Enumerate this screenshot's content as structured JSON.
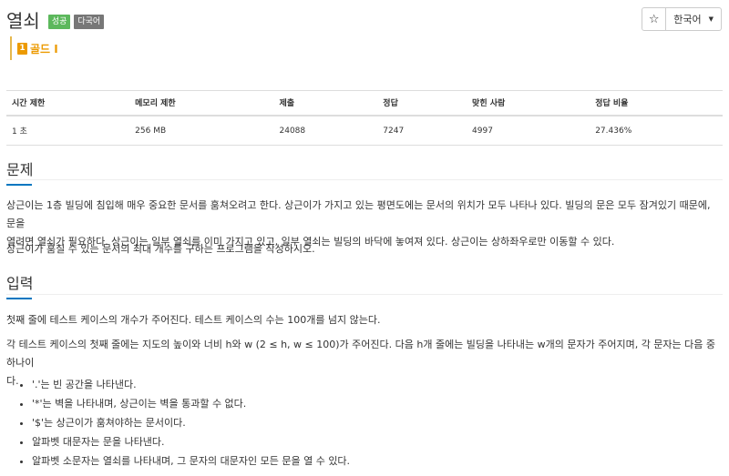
{
  "header": {
    "title": "열쇠",
    "badge_success": "성공",
    "badge_multilang": "다국어",
    "star_icon": "☆",
    "language": "한국어"
  },
  "tier": {
    "icon_text": "1",
    "label": "골드 I"
  },
  "stats": {
    "headers": [
      "시간 제한",
      "메모리 제한",
      "제출",
      "정답",
      "맞힌 사람",
      "정답 비율"
    ],
    "values": [
      "1 초",
      "256 MB",
      "24088",
      "7247",
      "4997",
      "27.436%"
    ]
  },
  "problem": {
    "title": "문제",
    "paragraph1_line1": "상근이는 1층 빌딩에 침입해 매우 중요한 문서를 훔쳐오려고 한다. 상근이가 가지고 있는 평면도에는 문서의 위치가 모두 나타나 있다. 빌딩의 문은 모두 잠겨있기 때문에, 문을",
    "paragraph1_line2": "열려면 열쇠가 필요하다. 상근이는 일부 열쇠를 이미 가지고 있고, 일부 열쇠는 빌딩의 바닥에 놓여져 있다. 상근이는 상하좌우로만 이동할 수 있다.",
    "paragraph2": "상근이가 훔칠 수 있는 문서의 최대 개수를 구하는 프로그램을 작성하시오."
  },
  "input": {
    "title": "입력",
    "paragraph1": "첫째 줄에 테스트 케이스의 개수가 주어진다. 테스트 케이스의 수는 100개를 넘지 않는다.",
    "paragraph2_line1": "각 테스트 케이스의 첫째 줄에는 지도의 높이와 너비 h와 w (2 ≤ h, w ≤ 100)가 주어진다. 다음 h개 줄에는 빌딩을 나타내는 w개의 문자가 주어지며, 각 문자는 다음 중 하나이",
    "paragraph2_line2": "다.",
    "bullets": [
      "'.'는 빈 공간을 나타낸다.",
      "'*'는 벽을 나타내며, 상근이는 벽을 통과할 수 없다.",
      "'$'는 상근이가 훔쳐야하는 문서이다.",
      "알파벳 대문자는 문을 나타낸다.",
      "알파벳 소문자는 열쇠를 나타내며, 그 문자의 대문자인 모든 문을 열 수 있다."
    ]
  },
  "colors": {
    "success_badge": "#5cb85c",
    "multilang_badge": "#777777",
    "gold_tier": "#ec9a00",
    "section_underline": "#0076c0"
  }
}
